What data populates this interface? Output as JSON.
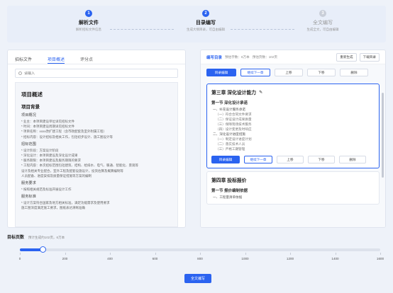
{
  "steps": [
    {
      "num": "1",
      "title": "解析文件",
      "sub": "解析招标文件信息",
      "state": "done"
    },
    {
      "num": "2",
      "title": "目录编写",
      "sub": "生成大纲目录，可自由编辑",
      "state": "active"
    },
    {
      "num": "3",
      "title": "全文编写",
      "sub": "生成全文，可自由编辑",
      "state": "pending"
    }
  ],
  "left": {
    "tabs": [
      "招标文件",
      "项目概述",
      "评分点"
    ],
    "active_tab": 1,
    "search_placeholder": "请输入",
    "doc_title": "项目概述",
    "section_title": "项目背景",
    "lines": [
      {
        "cls": "h3",
        "text": "项目概况"
      },
      {
        "cls": "line",
        "text": "* 业主：本项目建设单位详见招标文件"
      },
      {
        "cls": "line",
        "text": "* 时间：本项目建设周期详见招标文件"
      },
      {
        "cls": "line",
        "text": "* 项目名称：xxxx改扩建工程（含市政配套及室外附属工程）"
      },
      {
        "cls": "line",
        "text": "* 招标内容：设计招标及相关工作，包括初步设计、施工图设计等"
      },
      {
        "cls": "h3",
        "text": "招标范围"
      },
      {
        "cls": "line",
        "text": "* 设计阶段：方案设计阶段"
      },
      {
        "cls": "line",
        "text": "* 深化设计：本项目建设及深化设计成果"
      },
      {
        "cls": "line",
        "text": "* 服务期限：本项目建设及服务期限的要求"
      },
      {
        "cls": "line",
        "text": "* 工程内容：本次招标范围包括建筑、结构、给排水、电气、暖通、智能化、景观等"
      },
      {
        "cls": "line",
        "text": "  设计及相关专业配合，室外工程及配套设施设计，投资估算及概算编制等"
      },
      {
        "cls": "line",
        "text": "  人员配备、进度安排及质量保证措施等方案的编制"
      },
      {
        "cls": "h3",
        "text": "服务要求"
      },
      {
        "cls": "line",
        "text": "* 按照相关规范及标准开展设计工作"
      },
      {
        "cls": "h3",
        "text": "服务标准"
      },
      {
        "cls": "line",
        "text": "* 设计方案符合国家及地方相关标准，满足功能需求及使用要求"
      },
      {
        "cls": "line",
        "text": "  施工图深度满足施工要求，图纸表达清晰准确"
      }
    ]
  },
  "right": {
    "title": "编写目录",
    "stat1": "预估字数：6万本",
    "stat2": "预估页数：102页",
    "regen_label": "重新生成",
    "download_label": "下载目录",
    "action_labels": {
      "edit": "目录编辑",
      "continue": "继续下一章",
      "up": "上移",
      "down": "下移",
      "delete": "删除"
    },
    "card1": {
      "title": "第三章 深化设计能力",
      "sections": [
        {
          "title": "第一节 深化设计承诺",
          "items": [
            "一、补充设计服务承诺",
            "（一）符合合同文件要求",
            "（二）保证设计成果质量",
            "（三）保障现场技术服务",
            "（四）设计变更及时响应"
          ]
        },
        {
          "title": "二、深化设计进度措施",
          "items": [
            "（一）制定设计进度计划",
            "（二）落实技术人员",
            "（三）严格工期管理"
          ]
        }
      ]
    },
    "card2": {
      "title": "第四章 投标报价",
      "sections": [
        {
          "title": "第一节 报价编制依据",
          "items": [
            "一、工程量清单依据"
          ]
        }
      ]
    }
  },
  "slider": {
    "label": "目标页数",
    "hint": "预计生成约102页，6万本",
    "value": 102,
    "max": 1600,
    "ticks": [
      "0",
      "200",
      "400",
      "600",
      "800",
      "1000",
      "1200",
      "1400",
      "1600"
    ]
  },
  "generate_label": "全文编写",
  "colors": {
    "accent": "#2b63f0",
    "bg": "#eef2f9"
  }
}
